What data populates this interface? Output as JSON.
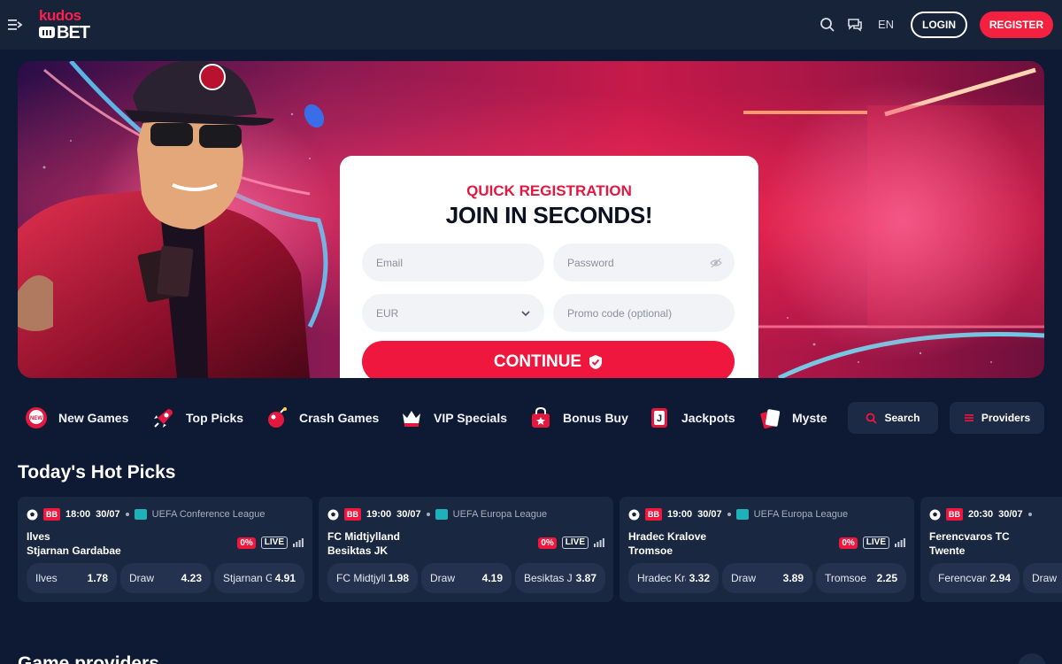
{
  "header": {
    "logo_top": "kudos",
    "logo_bottom": "BET",
    "language": "EN",
    "login_label": "LOGIN",
    "register_label": "REGISTER"
  },
  "registration": {
    "subtitle": "QUICK REGISTRATION",
    "title": "JOIN IN SECONDS!",
    "email_placeholder": "Email",
    "password_placeholder": "Password",
    "currency_value": "EUR",
    "promo_placeholder": "Promo code (optional)",
    "continue_label": "CONTINUE"
  },
  "categories": [
    {
      "label": "New Games",
      "icon": "new-badge-icon"
    },
    {
      "label": "Top Picks",
      "icon": "rocket-icon"
    },
    {
      "label": "Crash Games",
      "icon": "bomb-icon"
    },
    {
      "label": "VIP Specials",
      "icon": "crown-icon"
    },
    {
      "label": "Bonus Buy",
      "icon": "shopping-bag-icon"
    },
    {
      "label": "Jackpots",
      "icon": "jackpot-card-icon"
    },
    {
      "label": "Mystery",
      "icon": "mystery-cards-icon"
    }
  ],
  "search_label": "Search",
  "providers_label": "Providers",
  "hot_picks": {
    "title": "Today's Hot Picks",
    "matches": [
      {
        "badge": "BB",
        "time": "18:00",
        "date": "30/07",
        "league": "UEFA Conference League",
        "team1": "Ilves",
        "team2": "Stjarnan Gardabae",
        "percent": "0%",
        "live": "LIVE",
        "odds": [
          {
            "name": "Ilves",
            "value": "1.78"
          },
          {
            "name": "Draw",
            "value": "4.23"
          },
          {
            "name": "Stjarnan Gardabae",
            "value": "4.91"
          }
        ]
      },
      {
        "badge": "BB",
        "time": "19:00",
        "date": "30/07",
        "league": "UEFA Europa League",
        "team1": "FC Midtjylland",
        "team2": "Besiktas JK",
        "percent": "0%",
        "live": "LIVE",
        "odds": [
          {
            "name": "FC Midtjylland",
            "value": "1.98"
          },
          {
            "name": "Draw",
            "value": "4.19"
          },
          {
            "name": "Besiktas JK",
            "value": "3.87"
          }
        ]
      },
      {
        "badge": "BB",
        "time": "19:00",
        "date": "30/07",
        "league": "UEFA Europa League",
        "team1": "Hradec Kralove",
        "team2": "Tromsoe",
        "percent": "0%",
        "live": "LIVE",
        "odds": [
          {
            "name": "Hradec Kralove",
            "value": "3.32"
          },
          {
            "name": "Draw",
            "value": "3.89"
          },
          {
            "name": "Tromsoe",
            "value": "2.25"
          }
        ]
      },
      {
        "badge": "BB",
        "time": "20:30",
        "date": "30/07",
        "league": "",
        "team1": "Ferencvaros TC",
        "team2": "Twente",
        "percent": "",
        "live": "",
        "odds": [
          {
            "name": "Ferencvaros TC",
            "value": "2.94"
          },
          {
            "name": "Draw",
            "value": ""
          }
        ]
      }
    ]
  },
  "providers_section_title": "Game providers",
  "colors": {
    "background": "#0e1a33",
    "header": "#162338",
    "accent_red": "#f0173f",
    "card": "#1a2740",
    "odd_pill": "#24314f"
  }
}
